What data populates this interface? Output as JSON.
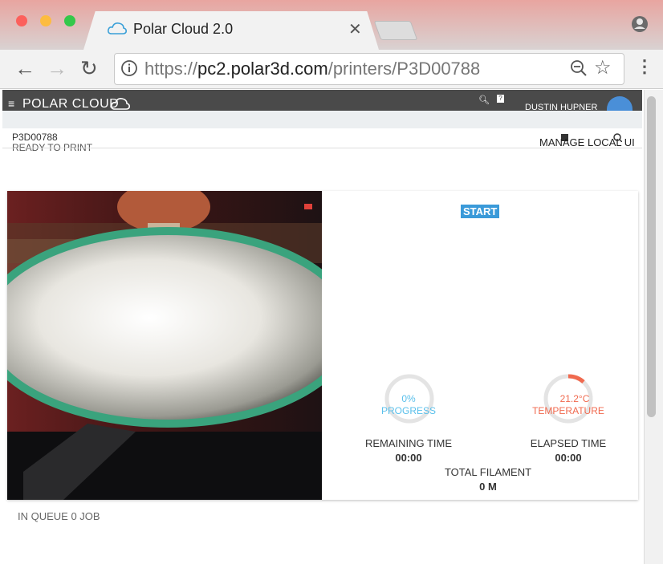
{
  "browser": {
    "tab_title": "Polar Cloud 2.0",
    "url_scheme": "https://",
    "url_host": "pc2.polar3d.com",
    "url_path": "/printers/P3D00788"
  },
  "app": {
    "logo_text": "POLAR CLOUD",
    "user_name": "DUSTIN HUPNER"
  },
  "printer": {
    "id": "P3D00788",
    "status": "READY TO PRINT",
    "actions": [
      "MANAGE",
      "LOCAL UI"
    ]
  },
  "control": {
    "start_label": "START",
    "progress_value": "0%",
    "progress_label": "PROGRESS",
    "progress_fraction": 0,
    "temperature_value": "21.2°C",
    "temperature_label": "TEMPERATURE",
    "remaining_label": "REMAINING TIME",
    "remaining_value": "00:00",
    "elapsed_label": "ELAPSED TIME",
    "elapsed_value": "00:00",
    "filament_label": "TOTAL FILAMENT",
    "filament_value": "0 M"
  },
  "queue": {
    "text": "IN QUEUE 0 JOB"
  },
  "colors": {
    "accent": "#3a9ad9",
    "progress": "#5bc0eb",
    "temperature": "#f06a4f"
  }
}
